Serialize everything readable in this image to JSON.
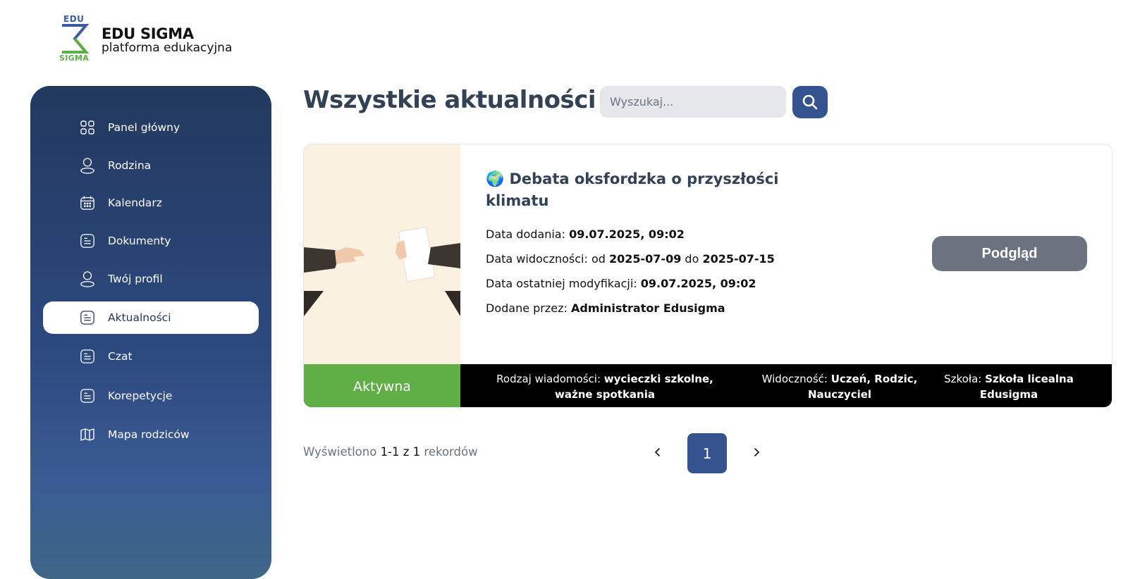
{
  "brand": {
    "mark_top": "EDU",
    "mark_bottom": "SIGMA",
    "title": "EDU SIGMA",
    "subtitle": "platforma edukacyjna"
  },
  "sidebar": {
    "items": [
      {
        "label": "Panel główny",
        "icon": "grid-icon"
      },
      {
        "label": "Rodzina",
        "icon": "user-icon"
      },
      {
        "label": "Kalendarz",
        "icon": "calendar-icon"
      },
      {
        "label": "Dokumenty",
        "icon": "document-icon"
      },
      {
        "label": "Twój profil",
        "icon": "user-icon"
      },
      {
        "label": "Aktualności",
        "icon": "document-icon",
        "active": true
      },
      {
        "label": "Czat",
        "icon": "document-icon"
      },
      {
        "label": "Korepetycje",
        "icon": "document-icon"
      },
      {
        "label": "Mapa rodziców",
        "icon": "map-icon"
      }
    ]
  },
  "header": {
    "title": "Wszystkie aktualności",
    "search_placeholder": "Wyszukaj..."
  },
  "news": {
    "title": "🌍 Debata oksfordzka o przyszłości klimatu",
    "added_label": "Data dodania: ",
    "added_value": "09.07.2025, 09:02",
    "visibility_label": "Data widoczności: od ",
    "visibility_from": "2025-07-09",
    "visibility_mid": " do ",
    "visibility_to": "2025-07-15",
    "modified_label": "Data ostatniej modyfikacji: ",
    "modified_value": "09.07.2025, 09:02",
    "author_label": "Dodane przez: ",
    "author_value": "Administrator Edusigma",
    "preview_button": "Podgląd",
    "status": "Aktywna",
    "type_label": "Rodzaj wiadomości: ",
    "type_value": "wycieczki szkolne, ważne spotkania",
    "visibility_to_label": "Widoczność: ",
    "visibility_to_value": "Uczeń, Rodzic, Nauczyciel",
    "school_label": "Szkoła: ",
    "school_value": "Szkoła licealna Edusigma"
  },
  "pagination": {
    "prefix": "Wyświetlono ",
    "range": "1-1",
    "mid": " z ",
    "total": "1",
    "suffix": " rekordów",
    "current_page": "1"
  },
  "colors": {
    "sidebar": "#2d4a80",
    "accent": "#34538f",
    "status_active": "#5fae46",
    "preview_btn": "#6b7280"
  }
}
